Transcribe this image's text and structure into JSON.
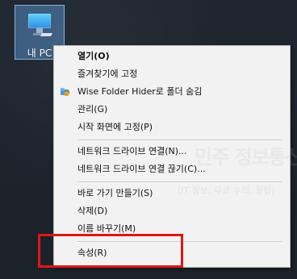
{
  "desktop": {
    "icon_label": "내 PC"
  },
  "context_menu": {
    "items": [
      {
        "label": "열기(O)",
        "bold": true,
        "icon": ""
      },
      {
        "label": "즐겨찾기에 고정",
        "bold": false,
        "icon": ""
      },
      {
        "label": "Wise Folder Hider로 폴더 숨김",
        "bold": false,
        "icon": "wise-folder-hider-icon"
      },
      {
        "label": "관리(G)",
        "bold": false,
        "icon": ""
      },
      {
        "label": "시작 화면에 고정(P)",
        "bold": false,
        "icon": ""
      },
      {
        "label": "네트워크 드라이브 연결(N)...",
        "bold": false,
        "icon": ""
      },
      {
        "label": "네트워크 드라이브 연결 끊기(C)...",
        "bold": false,
        "icon": ""
      },
      {
        "label": "바로 가기 만들기(S)",
        "bold": false,
        "icon": ""
      },
      {
        "label": "삭제(D)",
        "bold": false,
        "icon": ""
      },
      {
        "label": "이름 바꾸기(M)",
        "bold": false,
        "icon": ""
      },
      {
        "label": "속성(R)",
        "bold": false,
        "icon": ""
      }
    ]
  },
  "watermark": {
    "title": "민주 정보통신 수리 상가 상가야",
    "subtitle": "(IT 정보, 무료 수리, 꿀팁)"
  },
  "colors": {
    "desktop_background": "#1c2128",
    "menu_background": "#f2f2f2",
    "menu_border": "#b8b8b8",
    "selection_fill": "#5e98d7",
    "highlight_red": "#e01616"
  }
}
